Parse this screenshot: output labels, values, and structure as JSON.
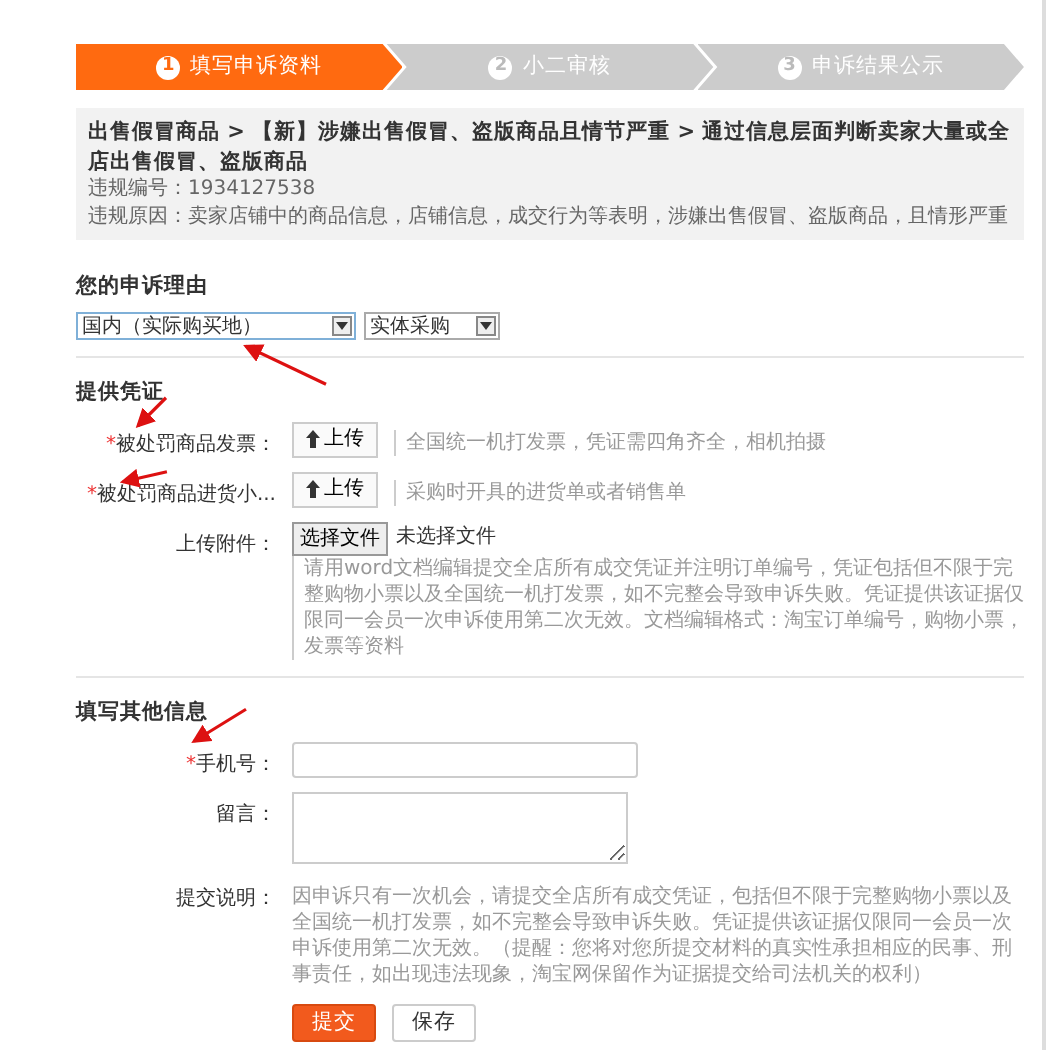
{
  "steps": [
    {
      "number": "1",
      "label": "填写申诉资料",
      "selected": true
    },
    {
      "number": "2",
      "label": "小二审核",
      "selected": false
    },
    {
      "number": "3",
      "label": "申诉结果公示",
      "selected": false
    }
  ],
  "info": {
    "path": "出售假冒商品 > 【新】涉嫌出售假冒、盗版商品且情节严重 > 通过信息层面判断卖家大量或全店出售假冒、盗版商品",
    "lines": [
      "违规编号：1934127538",
      "违规原因：卖家店铺中的商品信息，店铺信息，成交行为等表明，涉嫌出售假冒、盗版商品，且情形严重"
    ]
  },
  "reason": {
    "title": "您的申诉理由",
    "selects": [
      {
        "value": "国内（实际购买地）",
        "focused": true
      },
      {
        "value": "实体采购",
        "focused": false
      }
    ]
  },
  "evidence": {
    "title": "提供凭证",
    "rows": [
      {
        "kind": "upload",
        "required_mark": "*",
        "label": "被处罚商品发票：",
        "button": "上传",
        "hint": "全国统一机打发票，凭证需四角齐全，相机拍摄"
      },
      {
        "kind": "upload",
        "required_mark": "*",
        "label": "被处罚商品进货小...",
        "button": "上传",
        "hint": "采购时开具的进货单或者销售单"
      },
      {
        "kind": "file",
        "label": "上传附件：",
        "button": "选择文件",
        "file_status": "未选择文件",
        "hint": "请用word文档编辑提交全店所有成交凭证并注明订单编号，凭证包括但不限于完整购物小票以及全国统一机打发票，如不完整会导致申诉失败。凭证提供该证据仅限同一会员一次申诉使用第二次无效。文档编辑格式：淘宝订单编号，购物小票，发票等资料"
      }
    ]
  },
  "other": {
    "title": "填写其他信息",
    "rows": [
      {
        "kind": "input",
        "required_mark": "*",
        "label": "手机号："
      },
      {
        "kind": "textarea",
        "label": "留言："
      },
      {
        "kind": "note",
        "label": "提交说明：",
        "text": "因申诉只有一次机会，请提交全店所有成交凭证，包括但不限于完整购物小票以及全国统一机打发票，如不完整会导致申诉失败。凭证提供该证据仅限同一会员一次申诉使用第二次无效。（提醒：您将对您所提交材料的真实性承担相应的民事、刑事责任，如出现违法现象，淘宝网保留作为证据提交给司法机关的权利）"
      }
    ]
  },
  "buttons": [
    {
      "label": "提交",
      "primary": true
    },
    {
      "label": "保存",
      "primary": false
    }
  ]
}
